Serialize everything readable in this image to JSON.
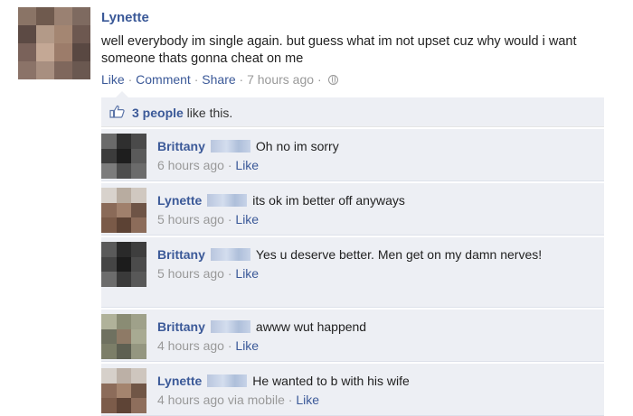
{
  "post": {
    "author": "Lynette",
    "text": "well everybody im single again. but guess what im not upset cuz why would i want someone thats gonna cheat on me",
    "actions": {
      "like": "Like",
      "comment": "Comment",
      "share": "Share",
      "time": "7 hours ago",
      "sep": "·",
      "privacy_icon": "globe-icon"
    }
  },
  "likes": {
    "count_link": "3 people",
    "suffix": " like this.",
    "icon": "thumbs-up-icon"
  },
  "comments": [
    {
      "name": "Brittany",
      "text": "Oh no im sorry",
      "time": "6 hours ago",
      "like": "Like"
    },
    {
      "name": "Lynette",
      "text": "its ok im better off anyways",
      "time": "5 hours ago",
      "like": "Like"
    },
    {
      "name": "Brittany",
      "text": "Yes u deserve better. Men get on my damn nerves!",
      "time": "5 hours ago",
      "like": "Like"
    },
    {
      "name": "Brittany",
      "text": "awww wut happend",
      "time": "4 hours ago",
      "like": "Like"
    },
    {
      "name": "Lynette",
      "text": "He wanted to b with his wife",
      "time": "4 hours ago via mobile",
      "like": "Like"
    }
  ],
  "colors": {
    "link": "#3b5998",
    "thread_bg": "#edeff4",
    "meta": "#999999"
  }
}
